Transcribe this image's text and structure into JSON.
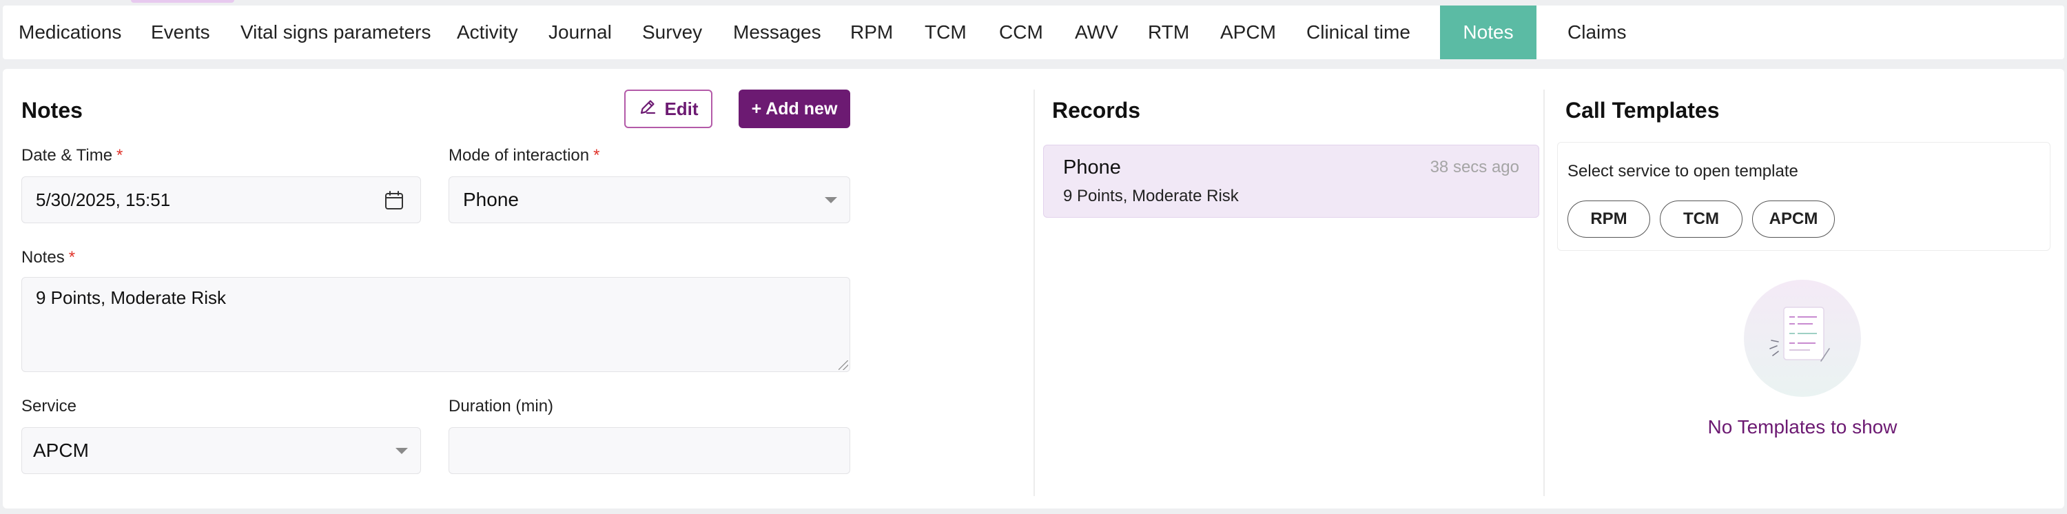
{
  "tabs": [
    {
      "label": "Medications",
      "active": false
    },
    {
      "label": "Events",
      "active": false
    },
    {
      "label": "Vital signs parameters",
      "active": false
    },
    {
      "label": "Activity",
      "active": false
    },
    {
      "label": "Journal",
      "active": false
    },
    {
      "label": "Survey",
      "active": false
    },
    {
      "label": "Messages",
      "active": false
    },
    {
      "label": "RPM",
      "active": false
    },
    {
      "label": "TCM",
      "active": false
    },
    {
      "label": "CCM",
      "active": false
    },
    {
      "label": "AWV",
      "active": false
    },
    {
      "label": "RTM",
      "active": false
    },
    {
      "label": "APCM",
      "active": false
    },
    {
      "label": "Clinical time",
      "active": false
    },
    {
      "label": "Notes",
      "active": true
    },
    {
      "label": "Claims",
      "active": false
    }
  ],
  "notes_panel": {
    "title": "Notes",
    "edit_label": "Edit",
    "add_new_label": "+ Add new",
    "required_marker": "*",
    "date_time": {
      "label": "Date & Time",
      "value": "5/30/2025, 15:51"
    },
    "mode": {
      "label": "Mode of interaction",
      "value": "Phone"
    },
    "notes": {
      "label": "Notes",
      "value": "9 Points, Moderate Risk"
    },
    "service": {
      "label": "Service",
      "value": "APCM"
    },
    "duration": {
      "label": "Duration (min)",
      "value": ""
    }
  },
  "records_panel": {
    "title": "Records",
    "items": [
      {
        "type": "Phone",
        "time": "38 secs ago",
        "note": "9 Points, Moderate Risk"
      }
    ]
  },
  "templates_panel": {
    "title": "Call Templates",
    "hint": "Select service to open template",
    "services": [
      "RPM",
      "TCM",
      "APCM"
    ],
    "empty_text": "No Templates to show"
  },
  "colors": {
    "active_tab": "#5bbba4",
    "brand_purple": "#6c1a72",
    "record_bg": "#f1e8f6",
    "required": "#e0342b"
  },
  "icons": {
    "edit": "pencil-icon",
    "date_picker": "calendar-icon",
    "dropdown": "chevron-down-icon",
    "empty_state": "document-illustration"
  }
}
